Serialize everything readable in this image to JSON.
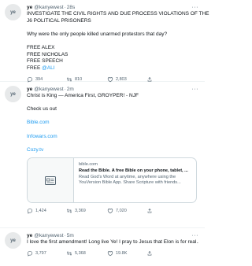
{
  "author": {
    "name": "ye",
    "handle": "@kanyewest",
    "avatar_label": "ye"
  },
  "more_label": "···",
  "tweets": [
    {
      "time": "28s",
      "lines": [
        "INVESTIGATE THE CIVIL RIGHTS AND DUE PROCESS VIOLATIONS OF THE",
        "J6 POLITICAL PRISONERS",
        "",
        "Why were the only people killed unarmed protestors that day?",
        "",
        "FREE ALEX",
        "FREE NICHOLAS",
        "FREE SPEECH"
      ],
      "last_line_prefix": "FREE ",
      "last_line_link": "@ALI",
      "replies": "394",
      "retweets": "810",
      "likes": "2,803"
    },
    {
      "time": "2m",
      "text_line": "Christ is King — America First, GROYPER! - NJF",
      "check": "Check us out",
      "links": [
        "Bible.com",
        "Infowars.com",
        "Cozy.tv"
      ],
      "card": {
        "domain": "bible.com",
        "title": "Read the Bible. A free Bible on your phone, tablet, ...",
        "desc_1": "Read God's Word at anytime, anywhere using the",
        "desc_2": "YouVersion Bible App. Share Scripture with friends..."
      },
      "replies": "1,424",
      "retweets": "3,369",
      "likes": "7,020"
    },
    {
      "time": "5m",
      "text_line": "I love the first amendment! Long live Ye! I pray to Jesus that Elon is for real...",
      "replies": "3,797",
      "retweets": "5,368",
      "likes": "19.8K"
    }
  ]
}
